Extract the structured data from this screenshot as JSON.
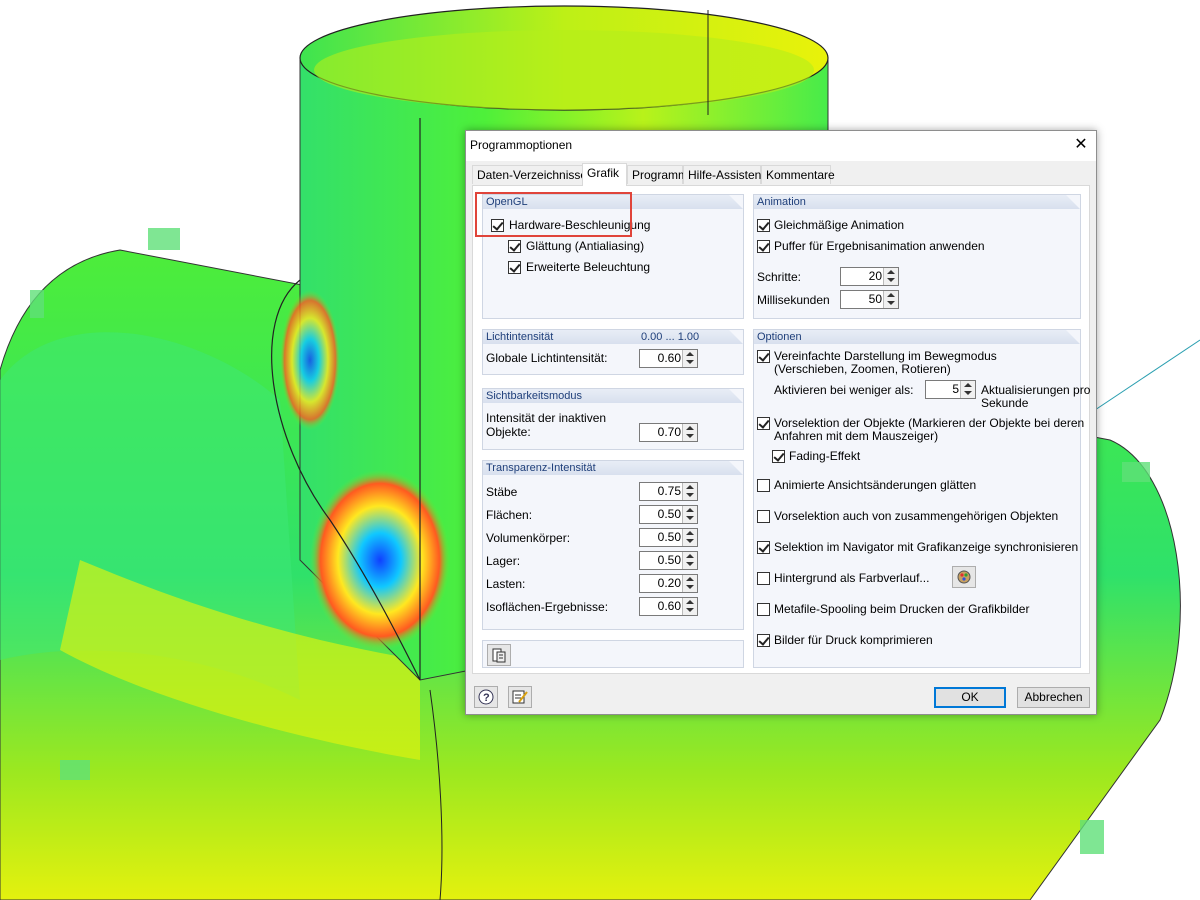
{
  "dialog": {
    "title": "Programmoptionen",
    "tabs": [
      "Daten-Verzeichnisse",
      "Grafik",
      "Programm",
      "Hilfe-Assistent",
      "Kommentare"
    ],
    "active_tab": "Grafik",
    "opengl": {
      "header": "OpenGL",
      "hardware": "Hardware-Beschleunigung",
      "antialias": "Glättung (Antialiasing)",
      "lighting": "Erweiterte Beleuchtung"
    },
    "light": {
      "header": "Lichtintensität",
      "range": "0.00 ... 1.00",
      "global_label": "Globale Lichtintensität:",
      "global_value": "0.60"
    },
    "visibility": {
      "header": "Sichtbarkeitsmodus",
      "label1": "Intensität der inaktiven",
      "label2": "Objekte:",
      "value": "0.70"
    },
    "transparency": {
      "header": "Transparenz-Intensität",
      "rows": [
        {
          "label": "Stäbe",
          "value": "0.75"
        },
        {
          "label": "Flächen:",
          "value": "0.50"
        },
        {
          "label": "Volumenkörper:",
          "value": "0.50"
        },
        {
          "label": "Lager:",
          "value": "0.50"
        },
        {
          "label": "Lasten:",
          "value": "0.20"
        },
        {
          "label": "Isoflächen-Ergebnisse:",
          "value": "0.60"
        }
      ]
    },
    "animation": {
      "header": "Animation",
      "even": "Gleichmäßige Animation",
      "buffer": "Puffer für Ergebnisanimation anwenden",
      "steps_label": "Schritte:",
      "steps_value": "20",
      "ms_label": "Millisekunden",
      "ms_value": "50"
    },
    "options": {
      "header": "Optionen",
      "simplified_1": "Vereinfachte Darstellung im Bewegmodus",
      "simplified_2": "(Verschieben, Zoomen, Rotieren)",
      "activate_label": "Aktivieren bei weniger als:",
      "activate_value": "5",
      "updates_1": "Aktualisierungen pro",
      "updates_2": "Sekunde",
      "preselect_1": "Vorselektion der Objekte (Markieren der Objekte bei deren",
      "preselect_2": "Anfahren mit dem Mauszeiger)",
      "fading": "Fading-Effekt",
      "animated": "Animierte Ansichtsänderungen glätten",
      "preselect_related": "Vorselektion auch von zusammengehörigen Objekten",
      "sync": "Selektion im Navigator mit Grafikanzeige synchronisieren",
      "gradient": "Hintergrund als Farbverlauf...",
      "metafile": "Metafile-Spooling beim Drucken der Grafikbilder",
      "compress": "Bilder für Druck komprimieren"
    },
    "ok": "OK",
    "cancel": "Abbrechen"
  }
}
